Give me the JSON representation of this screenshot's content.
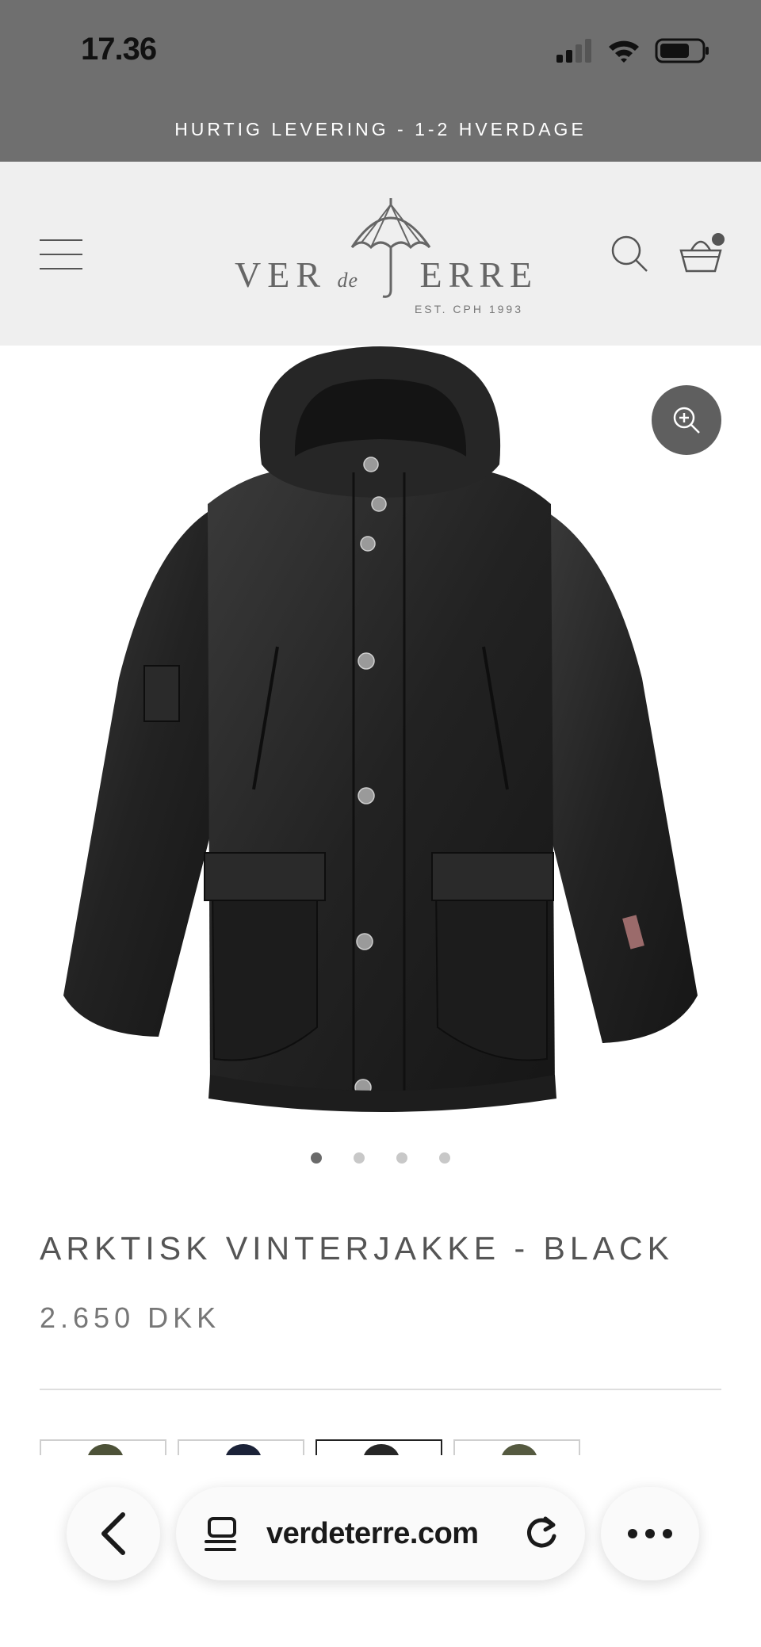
{
  "status_bar": {
    "time": "17.36",
    "signal_icon": "cellular-signal-icon",
    "wifi_icon": "wifi-icon",
    "battery_icon": "battery-icon"
  },
  "announcement": {
    "text": "HURTIG LEVERING - 1-2 HVERDAGE"
  },
  "header": {
    "menu_icon": "hamburger-menu-icon",
    "logo": {
      "name_part1": "VER",
      "name_part2": "de",
      "name_part3": "ERRE",
      "tagline": "EST. CPH 1993"
    },
    "search_icon": "search-icon",
    "basket_icon": "shopping-basket-icon",
    "basket_has_items": true
  },
  "product": {
    "zoom_icon": "zoom-in-icon",
    "image_count": 4,
    "active_image_index": 0,
    "title": "ARKTISK VINTERJAKKE - BLACK",
    "price": "2.650 DKK",
    "variants": [
      {
        "color": "#4d5238",
        "selected": false
      },
      {
        "color": "#1b2238",
        "selected": false
      },
      {
        "color": "#262626",
        "selected": true
      },
      {
        "color": "#555a40",
        "selected": false
      }
    ]
  },
  "browser": {
    "back_icon": "chevron-left-icon",
    "page_icon": "page-layout-icon",
    "url": "verdeterre.com",
    "reload_icon": "reload-icon",
    "more_icon": "more-horizontal-icon"
  },
  "colors": {
    "status_bg": "#6f6f6f",
    "header_bg": "#efefef",
    "text": "#555555"
  }
}
